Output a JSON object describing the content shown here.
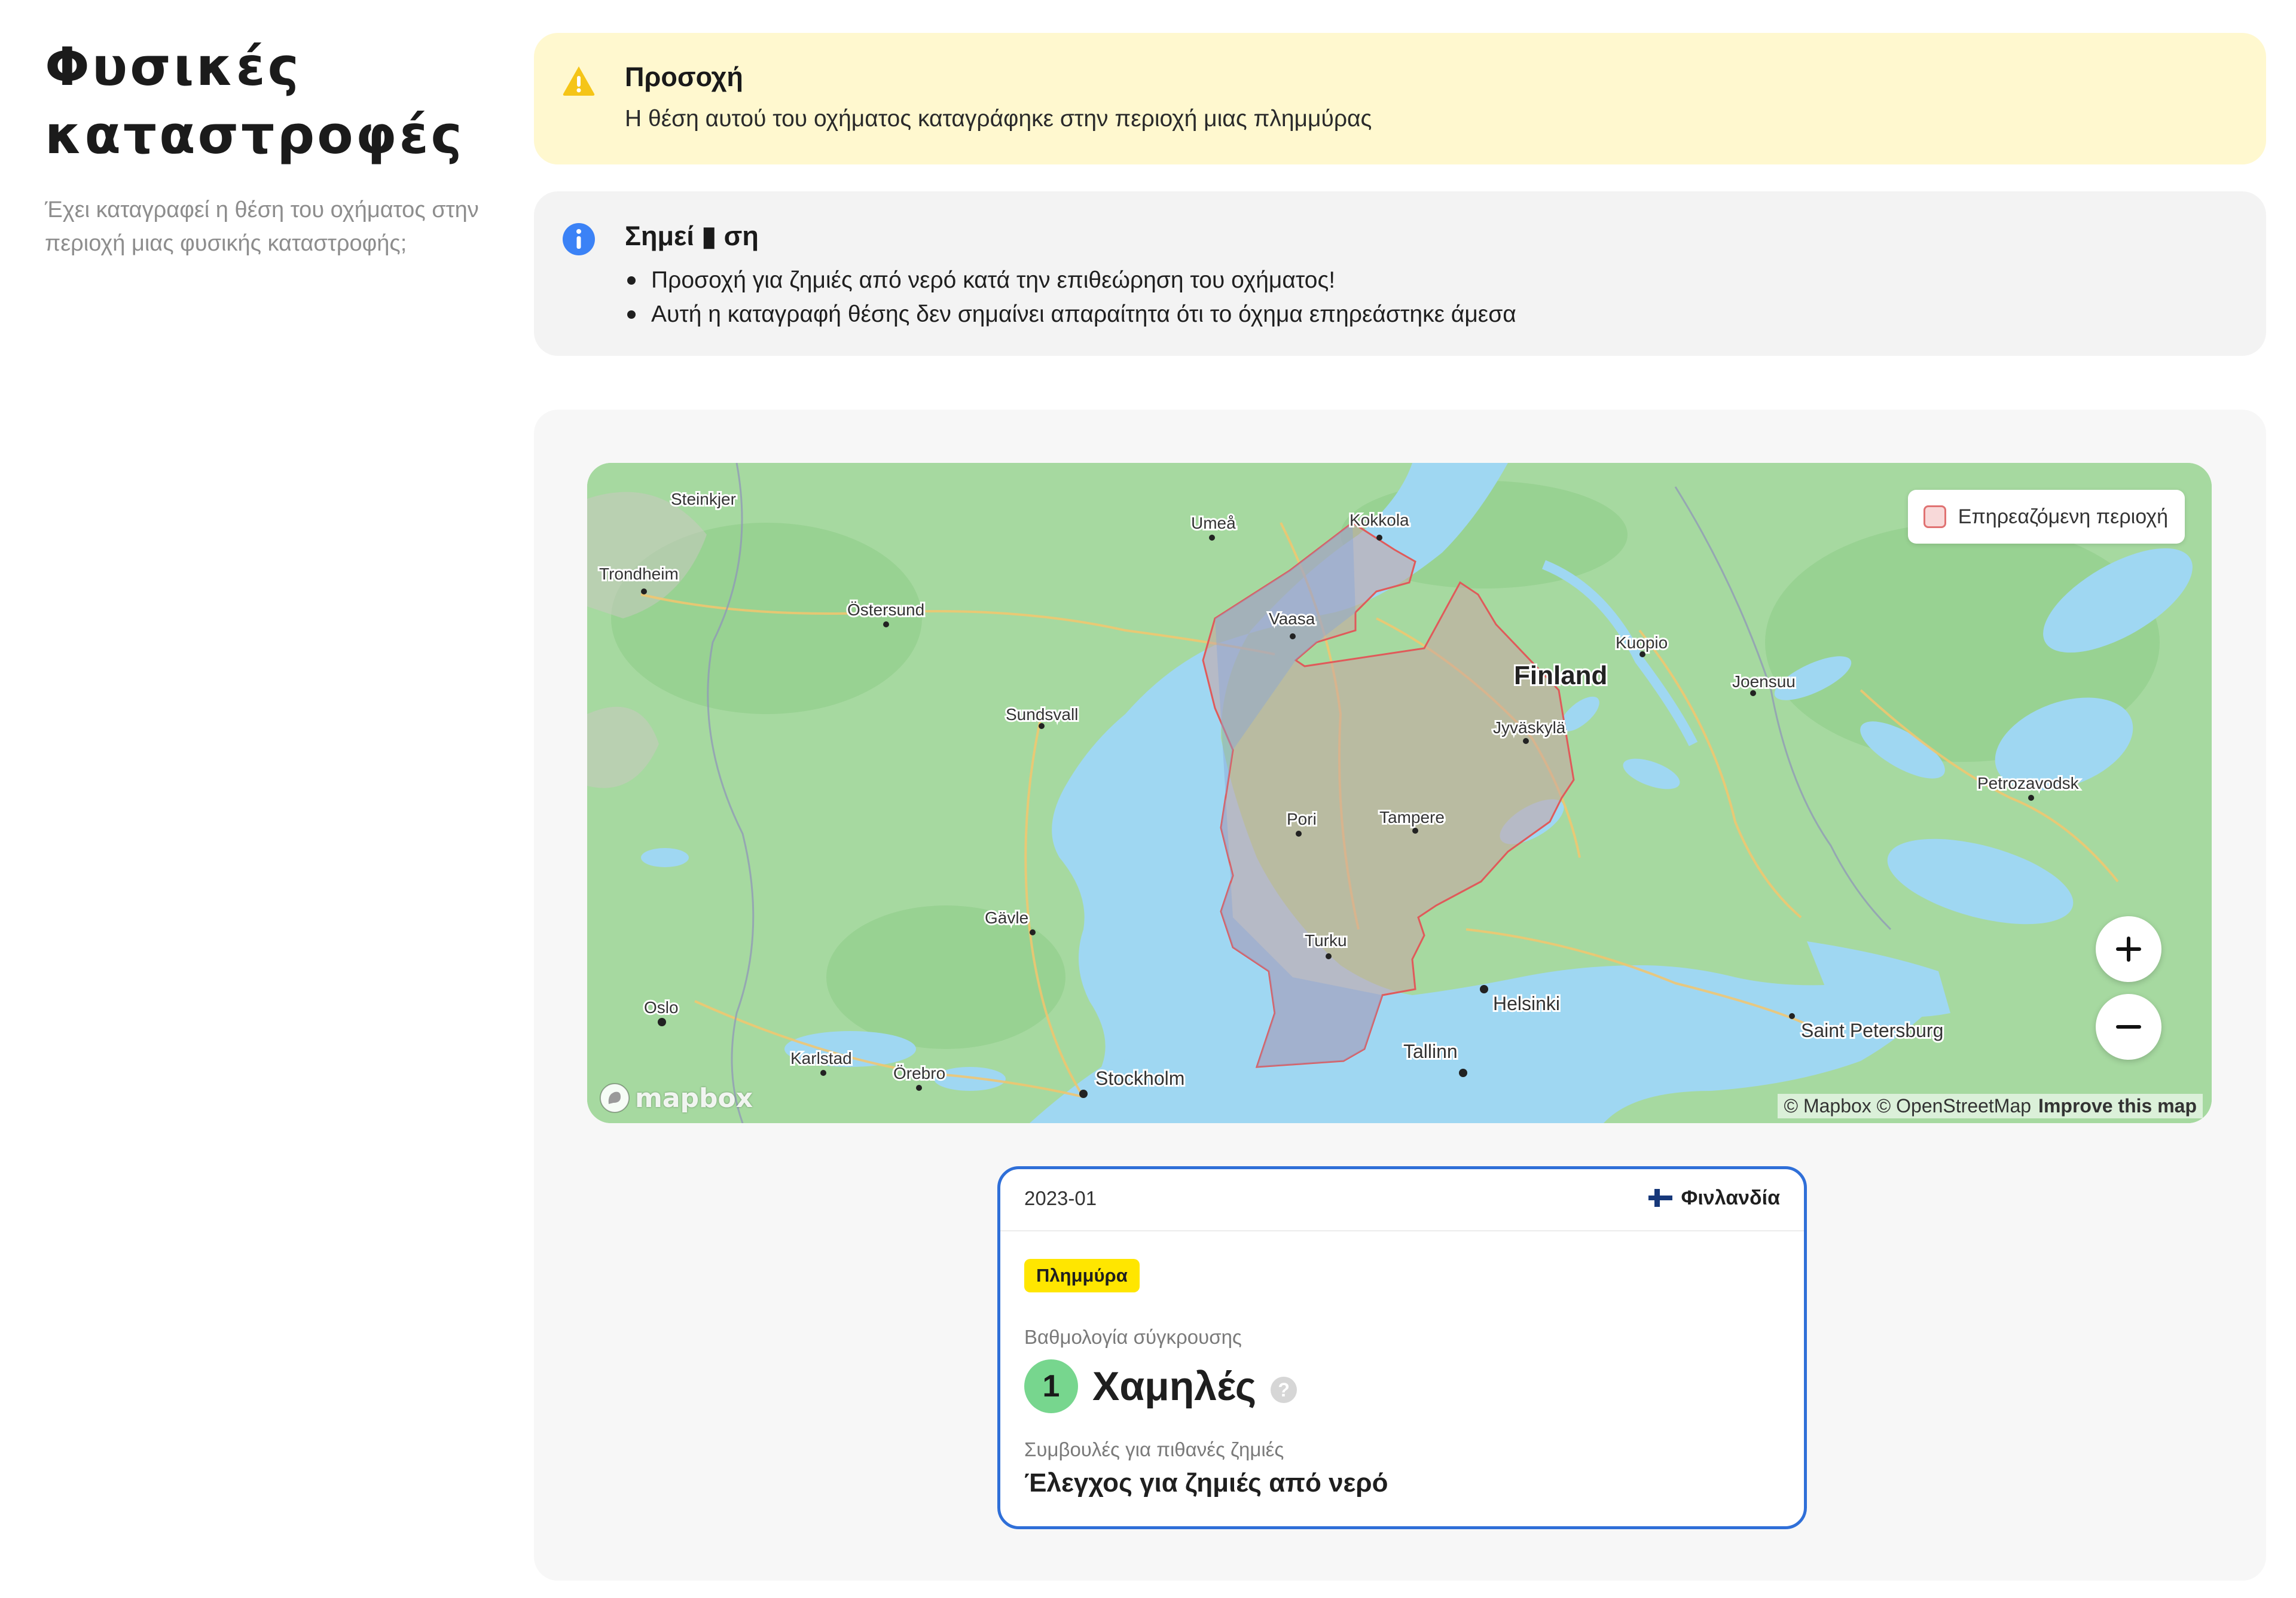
{
  "sidebar": {
    "title_line1": "Φυσικές",
    "title_line2": "καταστροφές",
    "description": "Έχει καταγραφεί η θέση του οχήματος στην περιοχή μιας φυσικής καταστροφής;"
  },
  "warning": {
    "title": "Προσοχή",
    "text": "Η θέση αυτού του οχήματος καταγράφηκε στην περιοχή μιας πλημμύρας",
    "icon": "warning-triangle-icon"
  },
  "info": {
    "title": "Σημεί ▮ ση",
    "items": [
      "Προσοχή για ζημιές από νερό κατά την επιθεώρηση του οχήματος!",
      "Αυτή η καταγραφή θέσης δεν σημαίνει απαραίτητα ότι το όχημα επηρεάστηκε άμεσα"
    ],
    "icon": "info-icon"
  },
  "map": {
    "legend_label": "Επηρεαζόμενη περιοχή",
    "country_label": "Finland",
    "cities": [
      "Steinkjer",
      "Trondheim",
      "Östersund",
      "Umeå",
      "Sundsvall",
      "Gävle",
      "Oslo",
      "Karlstad",
      "Örebro",
      "Stockholm",
      "Kokkola",
      "Vaasa",
      "Pori",
      "Tampere",
      "Turku",
      "Jyväskylä",
      "Kuopio",
      "Joensuu",
      "Petrozavodsk",
      "Helsinki",
      "Tallinn",
      "Saint Petersburg"
    ],
    "attribution": "© Mapbox © OpenStreetMap",
    "improve_link": "Improve this map",
    "logo_text": "mapbox",
    "zoom_in_icon": "plus-icon",
    "zoom_out_icon": "minus-icon",
    "affected_color": "#e05a5a"
  },
  "event": {
    "date": "2023-01",
    "country": "Φινλανδία",
    "type_badge": "Πλημμύρα",
    "score_label": "Βαθμολογία σύγκρουσης",
    "score_value": "1",
    "score_text": "Χαμηλές",
    "advice_label": "Συμβουλές για πιθανές ζημιές",
    "advice_value": "Έλεγχος για ζημιές από νερό",
    "help_icon": "?"
  },
  "colors": {
    "warning_bg": "#fff8cf",
    "info_bg": "#f3f3f3",
    "accent_blue": "#2f6fd8",
    "badge_yellow": "#ffe600",
    "score_green": "#77d68e"
  }
}
